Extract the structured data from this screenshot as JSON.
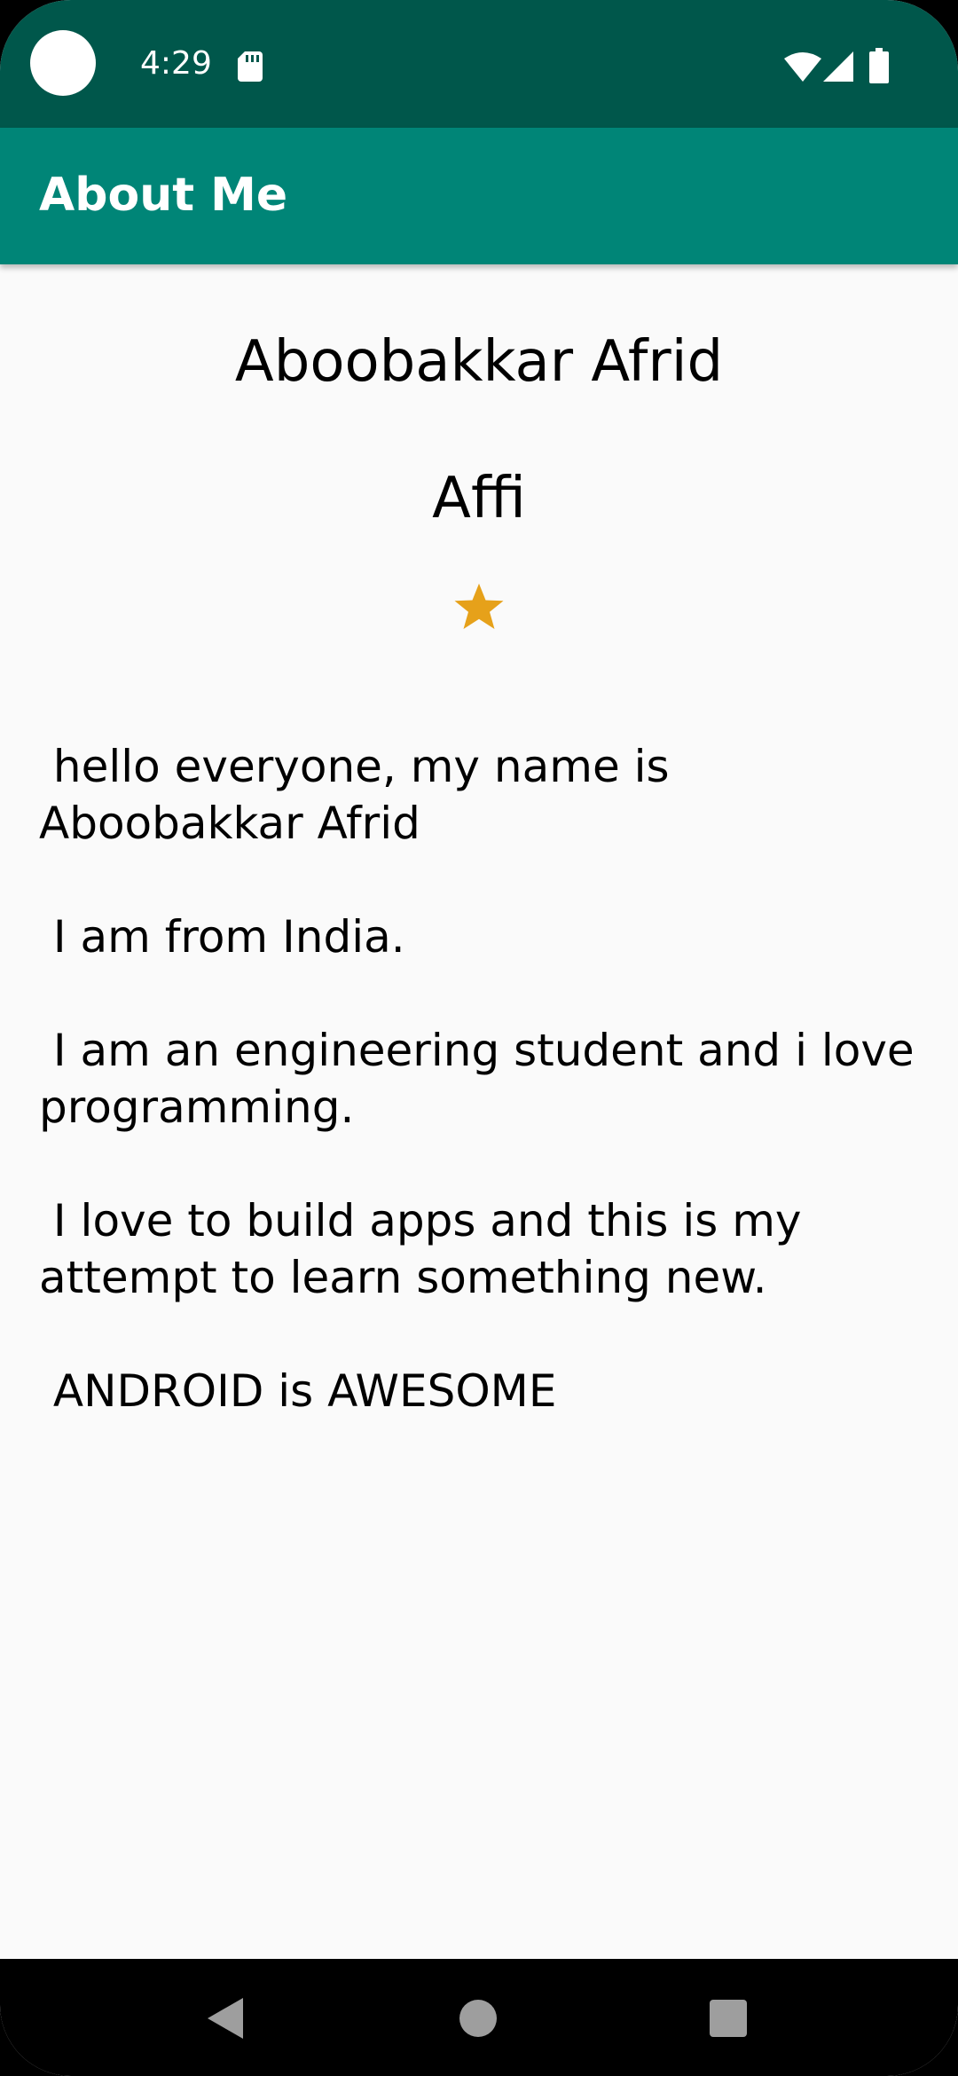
{
  "status_bar": {
    "time": "4:29",
    "icons": [
      "sd-card-icon",
      "wifi-icon",
      "signal-icon",
      "battery-icon"
    ]
  },
  "app_bar": {
    "title": "About Me"
  },
  "profile": {
    "name": "Aboobakkar Afrid",
    "nickname": "Affi",
    "star_color": "#e6a11a",
    "bio": " hello everyone, my name is Aboobakkar Afrid\n\n I am from India.\n\n I am an engineering student and i love programming.\n\n I love to build apps and this is my attempt to learn something new.\n\n ANDROID is AWESOME"
  },
  "colors": {
    "status_bar": "#00574b",
    "app_bar": "#008577",
    "background": "#fafafa"
  },
  "nav_bar": {
    "icons": [
      "back-icon",
      "home-icon",
      "recents-icon"
    ]
  }
}
